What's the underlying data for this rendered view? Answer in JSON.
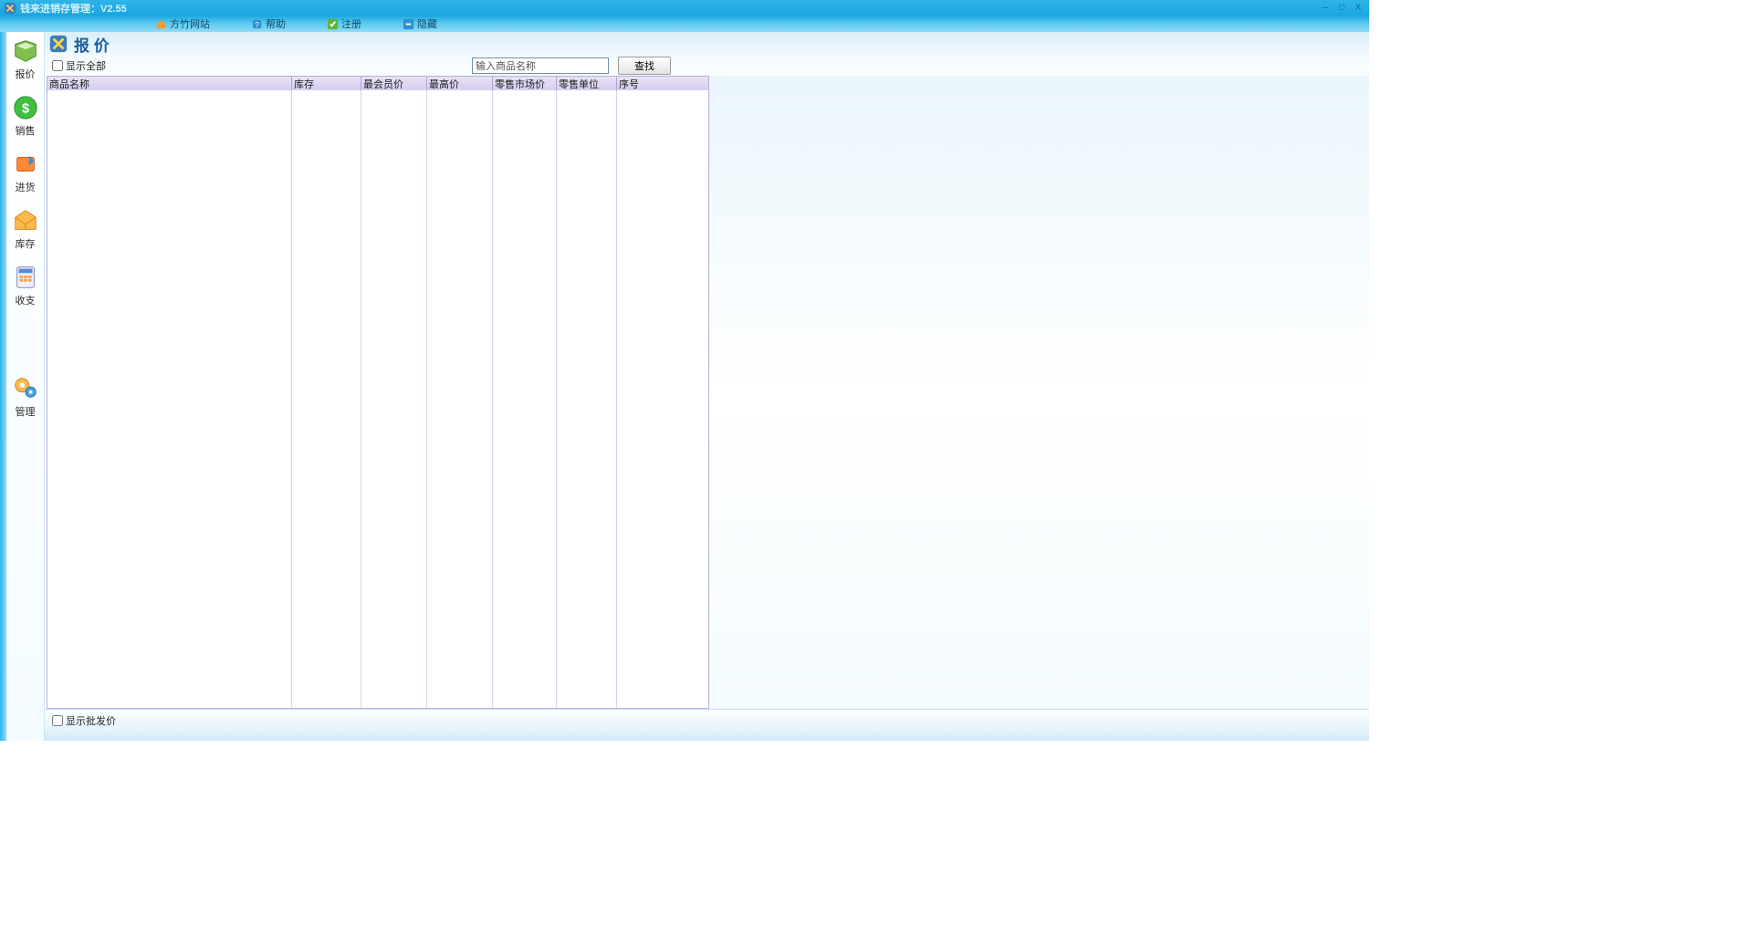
{
  "app": {
    "title": "钱来进销存管理：V2.55"
  },
  "window_controls": {
    "minimize": "–",
    "maximize": "□",
    "close": "X"
  },
  "menu": {
    "site": "方竹网站",
    "help": "帮助",
    "register": "注册",
    "hide": "隐藏"
  },
  "sidebar": {
    "quote": "报价",
    "sales": "销售",
    "purchase": "进货",
    "stock": "库存",
    "finance": "收支",
    "manage": "管理"
  },
  "page": {
    "title": "报 价",
    "show_all_label": "显示全部",
    "search_placeholder": "输入商品名称",
    "search_btn": "查找",
    "show_wholesale_label": "显示批发价"
  },
  "table": {
    "columns": [
      "商品名称",
      "库存",
      "最会员价",
      "最高价",
      "零售市场价",
      "零售单位",
      "序号"
    ],
    "rows": []
  }
}
